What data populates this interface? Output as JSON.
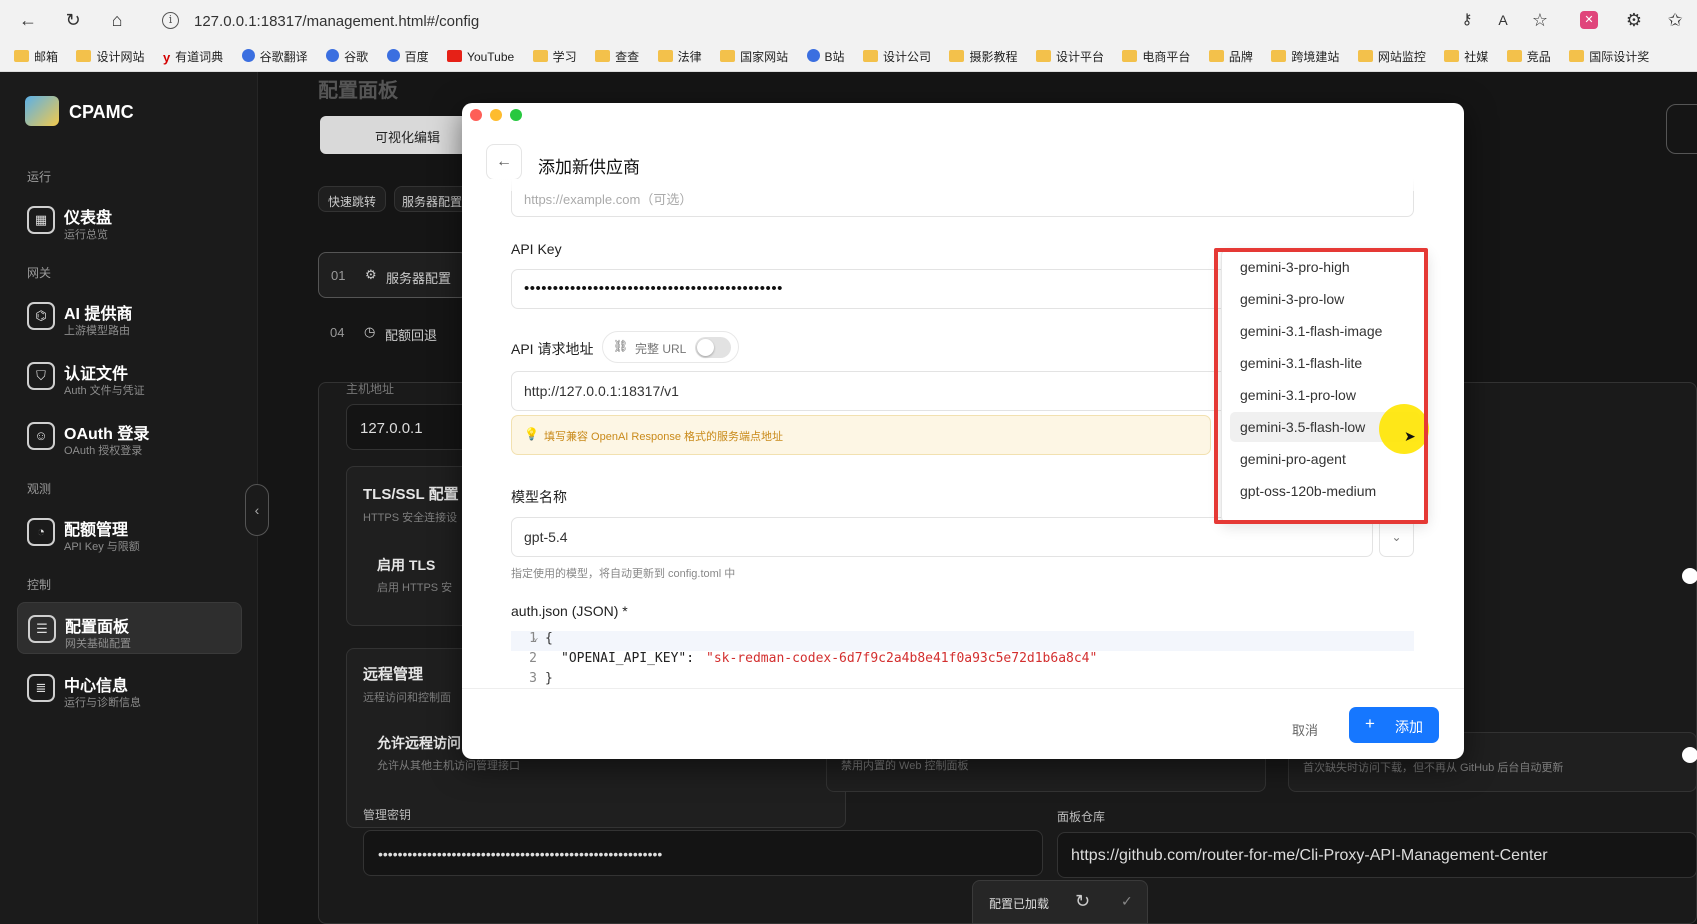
{
  "browser": {
    "url": "127.0.0.1:18317/management.html#/config",
    "bookmarks": [
      "邮箱",
      "设计网站",
      "有道词典",
      "谷歌翻译",
      "谷歌",
      "百度",
      "YouTube",
      "学习",
      "查查",
      "法律",
      "国家网站",
      "B站",
      "设计公司",
      "摄影教程",
      "设计平台",
      "电商平台",
      "品牌",
      "跨境建站",
      "网站监控",
      "社媒",
      "竞品",
      "国际设计奖"
    ]
  },
  "sidebar": {
    "app_name": "CPAMC",
    "sections": {
      "run": "运行",
      "gateway": "网关",
      "observe": "观测",
      "control": "控制"
    },
    "items": [
      {
        "title": "仪表盘",
        "sub": "运行总览"
      },
      {
        "title": "AI 提供商",
        "sub": "上游模型路由"
      },
      {
        "title": "认证文件",
        "sub": "Auth 文件与凭证"
      },
      {
        "title": "OAuth 登录",
        "sub": "OAuth 授权登录"
      },
      {
        "title": "配额管理",
        "sub": "API Key 与限额"
      },
      {
        "title": "配置面板",
        "sub": "网关基础配置"
      },
      {
        "title": "中心信息",
        "sub": "运行与诊断信息"
      }
    ]
  },
  "background": {
    "page_title": "配置面板",
    "visual_edit_tab": "可视化编辑",
    "quick_jump": "快速跳转",
    "server_config_chip": "服务器配置",
    "nav_01_num": "01",
    "nav_01_label": "服务器配置",
    "nav_04_num": "04",
    "nav_04_label": "配额回退",
    "host_label": "主机地址",
    "host_value": "127.0.0.1",
    "tls_title": "TLS/SSL 配置",
    "tls_sub": "HTTPS 安全连接设",
    "enable_tls_title": "启用 TLS",
    "enable_tls_sub": "启用 HTTPS 安",
    "remote_title": "远程管理",
    "remote_sub": "远程访问和控制面",
    "allow_remote_title": "允许远程访问",
    "allow_remote_sub": "允许从其他主机访问管理接口",
    "disable_panel_sub": "禁用内置的 Web 控制面板",
    "auto_update_sub": "首次缺失时访问下载，但不再从 GitHub 后台自动更新",
    "mgmt_key_label": "管理密钥",
    "mgmt_key_value": "••••••••••••••••••••••••••••••••••••••••••••••••••••••••••",
    "repo_label": "面板仓库",
    "repo_value": "https://github.com/router-for-me/Cli-Proxy-API-Management-Center",
    "status_text": "配置已加载"
  },
  "modal": {
    "title": "添加新供应商",
    "base_url_placeholder": "https://example.com（可选）",
    "api_key_label": "API Key",
    "api_key_value": "•••••••••••••••••••••••••••••••••••••••••••••",
    "api_url_label": "API 请求地址",
    "full_url_label": "完整 URL",
    "api_url_value": "http://127.0.0.1:18317/v1",
    "tip_text": "填写兼容 OpenAI Response 格式的服务端点地址",
    "model_label": "模型名称",
    "model_value": "gpt-5.4",
    "model_hint": "指定使用的模型，将自动更新到 config.toml 中",
    "auth_label": "auth.json (JSON) *",
    "code": {
      "l1": "1",
      "l2": "2",
      "l3": "3",
      "open": "{",
      "key": "\"OPENAI_API_KEY\":",
      "value": "\"sk-redman-codex-6d7f9c2a4b8e41f0a93c5e72d1b6a8c4\"",
      "close": "}"
    },
    "cancel": "取消",
    "add": "添加"
  },
  "dropdown": {
    "options": [
      "gemini-3-pro-high",
      "gemini-3-pro-low",
      "gemini-3.1-flash-image",
      "gemini-3.1-flash-lite",
      "gemini-3.1-pro-low",
      "gemini-3.5-flash-low",
      "gemini-pro-agent",
      "gpt-oss-120b-medium"
    ],
    "hovered": "gemini-3.5-flash-low"
  },
  "colors": {
    "accent": "#1677ff",
    "highlight": "#e53935",
    "cursor": "#ffe600"
  }
}
